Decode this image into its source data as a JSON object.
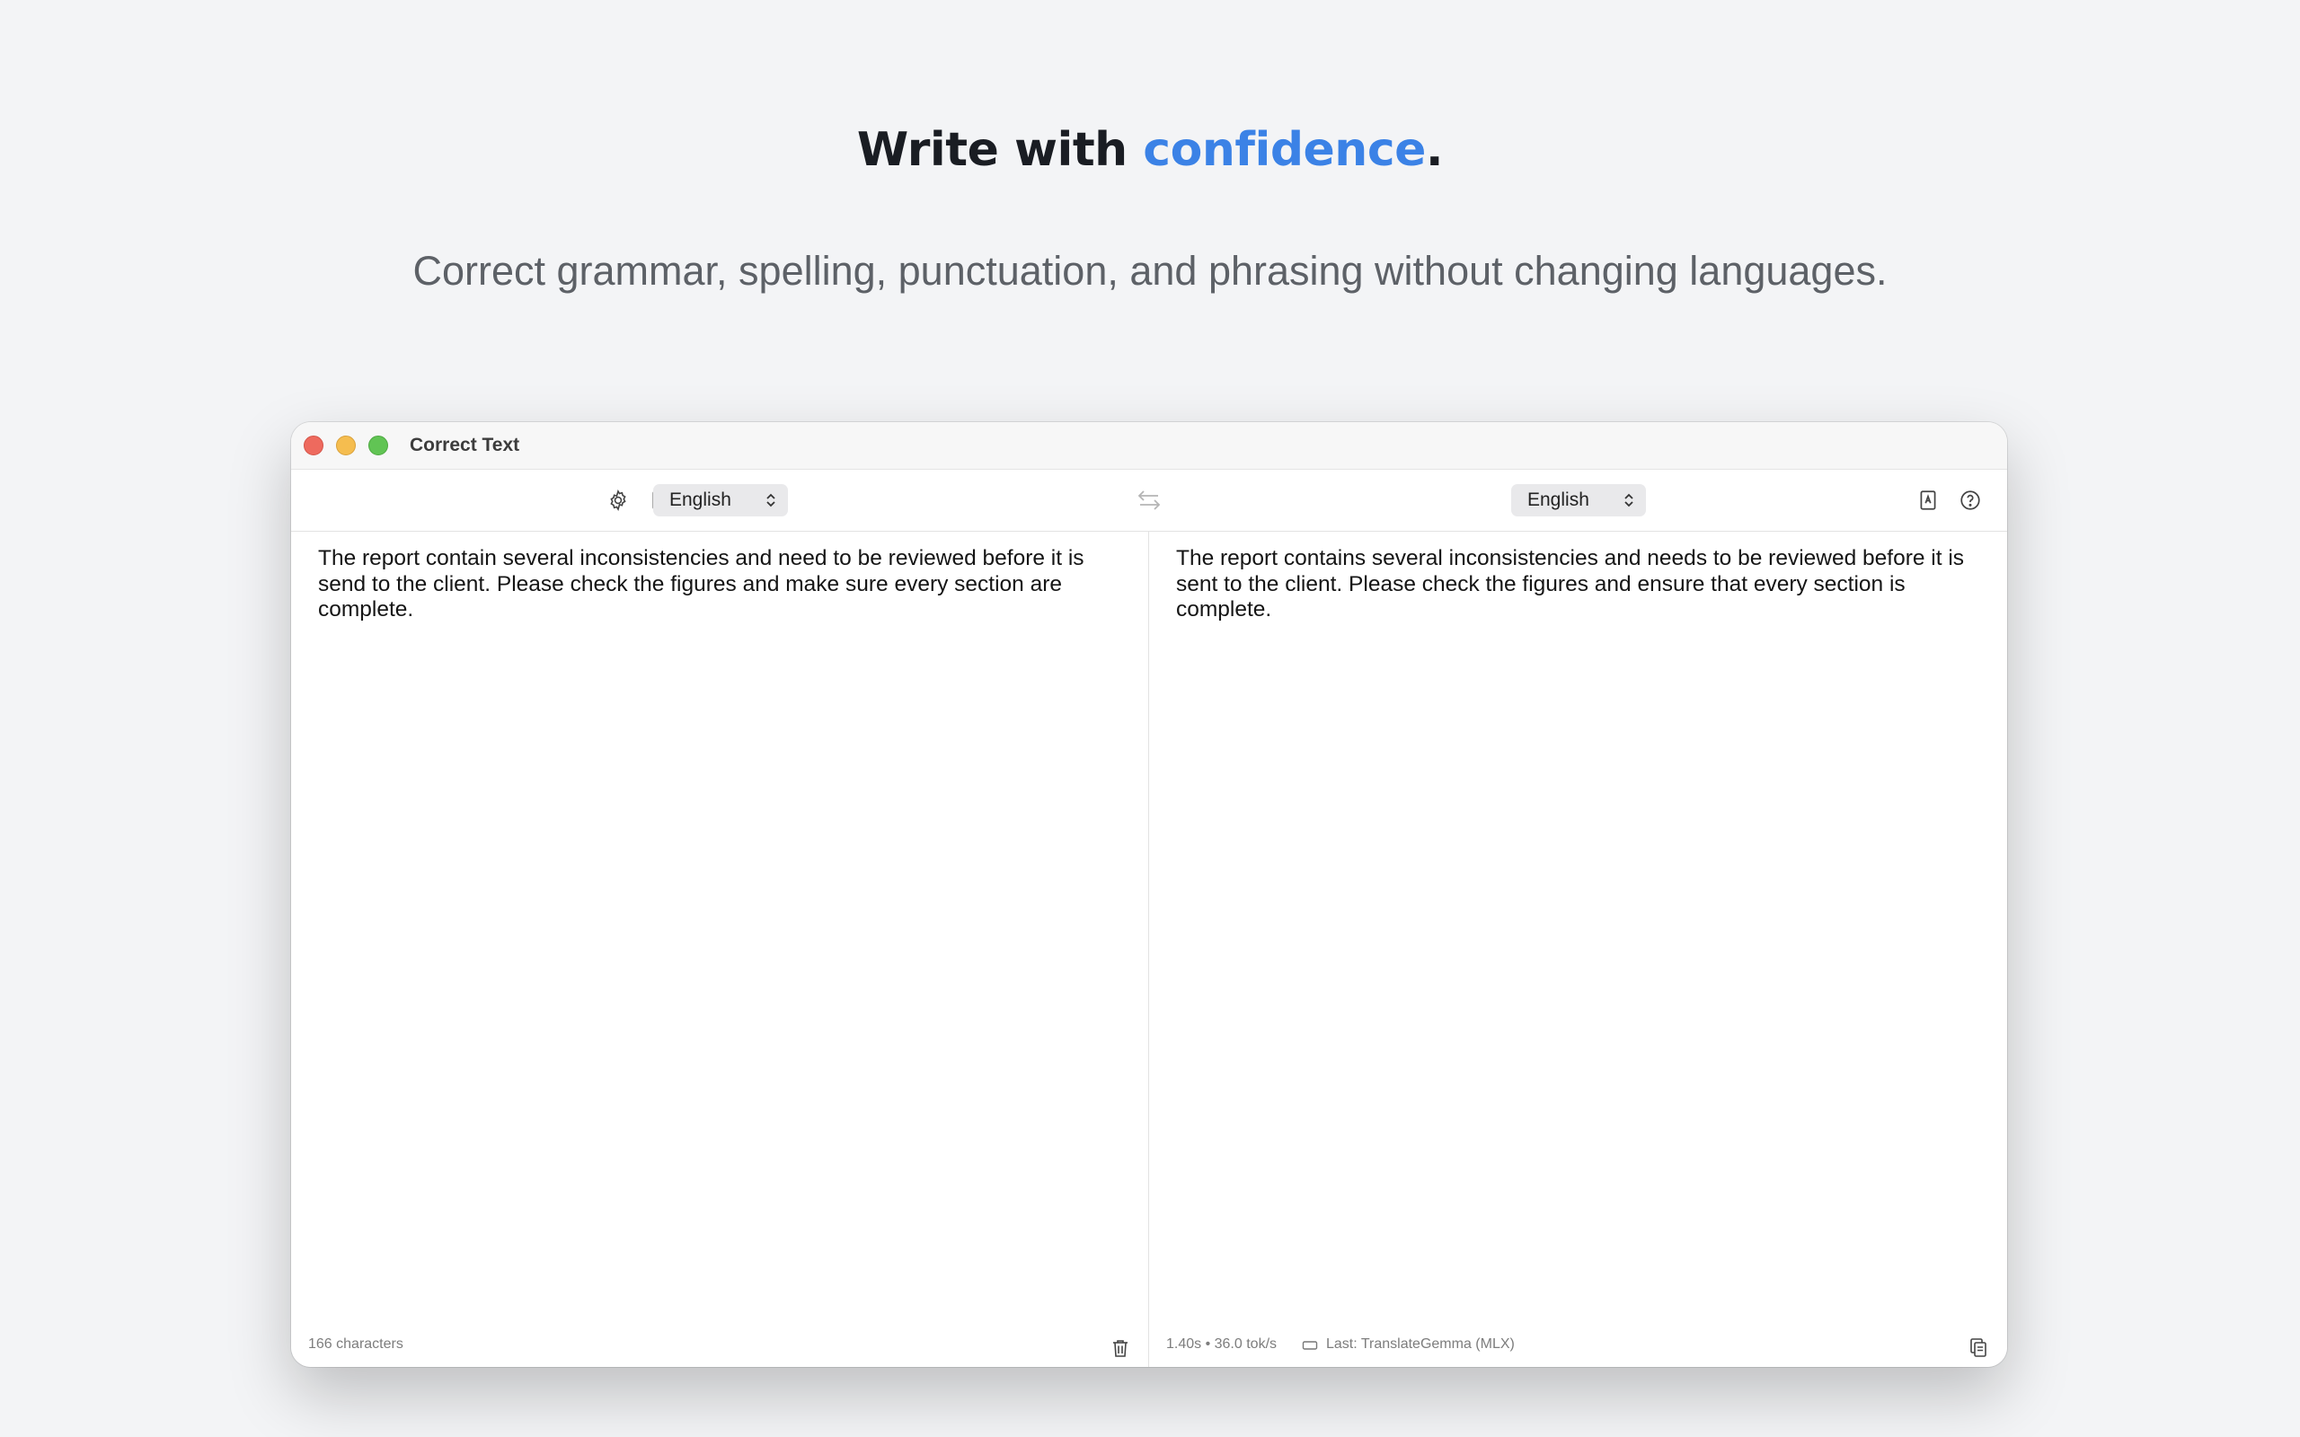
{
  "hero": {
    "headline_prefix": "Write with ",
    "headline_accent": "confidence",
    "headline_suffix": ".",
    "subheadline": "Correct grammar, spelling, punctuation, and phrasing without changing languages.",
    "accent_color": "#3b82e6"
  },
  "window": {
    "title": "Correct Text",
    "traffic_lights": [
      "close",
      "minimize",
      "zoom"
    ]
  },
  "toolbar": {
    "left_icons": [
      "gear-icon",
      "book-icon",
      "chat-bubbles-icon"
    ],
    "source_language": "English",
    "target_language": "English",
    "swap_icon": "swap-arrows-icon",
    "right_icons": [
      "dictionary-icon",
      "help-icon"
    ]
  },
  "source_pane": {
    "text": "The report contain several inconsistencies and need to be reviewed before it is send to the client. Please check the figures and make sure every section are complete.",
    "character_count": "166 characters",
    "clear_icon": "trash-icon"
  },
  "result_pane": {
    "text": "The report contains several inconsistencies and needs to be reviewed before it is sent to the client. Please check the figures and ensure that every section is complete.",
    "stats": "1.40s • 36.0 tok/s",
    "model": "Last: TranslateGemma (MLX)",
    "copy_icon": "copy-icon"
  }
}
